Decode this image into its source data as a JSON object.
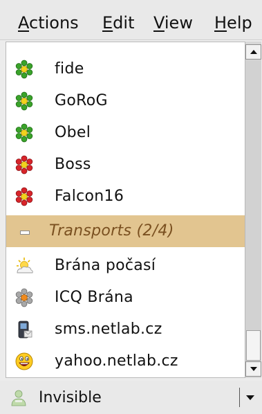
{
  "menubar": {
    "items": [
      {
        "mnemonic": "A",
        "rest": "ctions"
      },
      {
        "mnemonic": "E",
        "rest": "dit"
      },
      {
        "mnemonic": "V",
        "rest": "iew"
      },
      {
        "mnemonic": "H",
        "rest": "elp"
      }
    ]
  },
  "contacts": [
    {
      "label": "fide",
      "status": "online",
      "icon": "icq-flower-green-icon"
    },
    {
      "label": "GoRoG",
      "status": "online",
      "icon": "icq-flower-green-icon"
    },
    {
      "label": "Obel",
      "status": "online",
      "icon": "icq-flower-green-icon"
    },
    {
      "label": "Boss",
      "status": "offline",
      "icon": "icq-flower-red-icon"
    },
    {
      "label": "Falcon16",
      "status": "offline",
      "icon": "icq-flower-red-icon"
    }
  ],
  "group": {
    "label": "Transports (2/4)",
    "collapsed_marker": "minus-icon"
  },
  "transports": [
    {
      "label": "Brána počasí",
      "icon": "weather-sun-cloud-icon"
    },
    {
      "label": "ICQ Brána",
      "icon": "icq-flower-gray-icon"
    },
    {
      "label": "sms.netlab.cz",
      "icon": "mobile-phone-icon"
    },
    {
      "label": "yahoo.netlab.cz",
      "icon": "yahoo-smiley-icon"
    }
  ],
  "status": {
    "label": "Invisible",
    "icon": "invisible-person-icon"
  },
  "colors": {
    "online": "#3aa32a",
    "offline": "#d8242a",
    "group_bg": "#e2c590",
    "group_text": "#7a5020"
  }
}
